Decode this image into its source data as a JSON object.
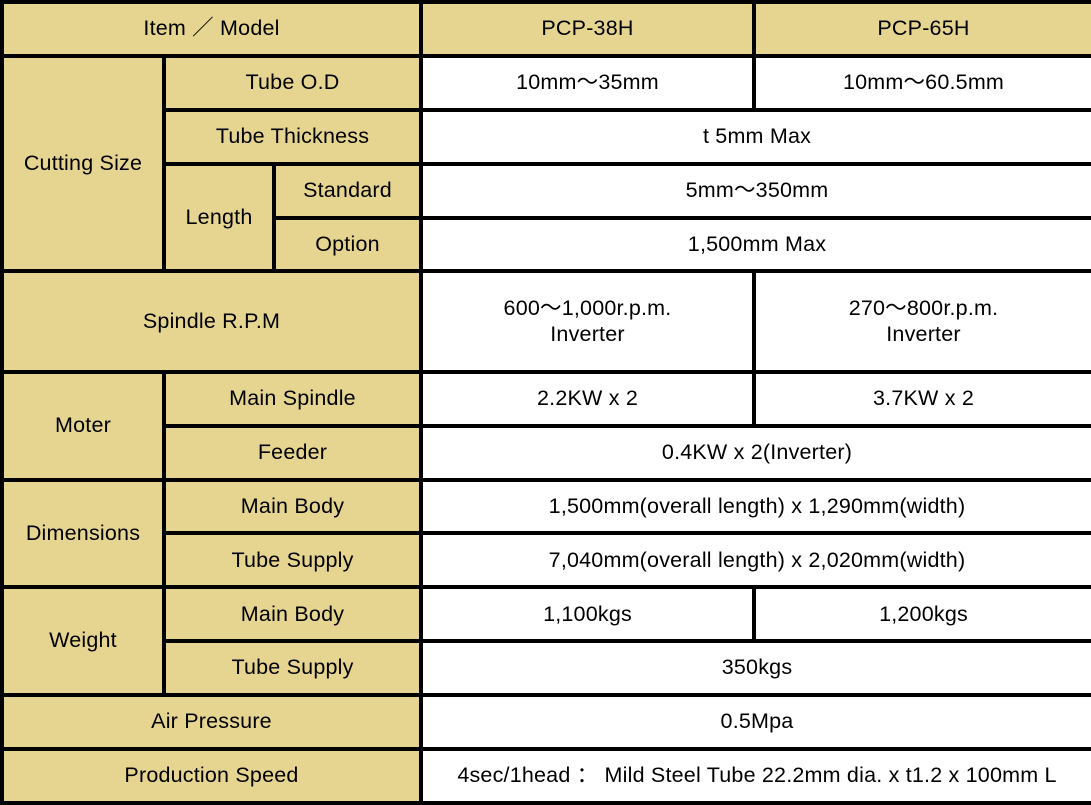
{
  "table": {
    "header": {
      "item_model": "Item ／ Model",
      "models": [
        "PCP-38H",
        "PCP-65H"
      ]
    },
    "colors": {
      "label_background": "#E5D590",
      "value_background": "#FFFFFF",
      "border": "#000000",
      "text": "#000000"
    },
    "rows": {
      "cutting_size": {
        "label": "Cutting Size",
        "tube_od": {
          "label": "Tube O.D",
          "pcp38h": "10mm～35mm",
          "pcp65h": "10mm～60.5mm"
        },
        "tube_thickness": {
          "label": "Tube Thickness",
          "value": "t 5mm Max"
        },
        "length": {
          "label": "Length",
          "standard": {
            "label": "Standard",
            "value": "5mm～350mm"
          },
          "option": {
            "label": "Option",
            "value": "1,500mm Max"
          }
        }
      },
      "spindle_rpm": {
        "label": "Spindle R.P.M",
        "pcp38h_line1": "600～1,000r.p.m.",
        "pcp38h_line2": "Inverter",
        "pcp65h_line1": "270～800r.p.m.",
        "pcp65h_line2": "Inverter"
      },
      "moter": {
        "label": "Moter",
        "main_spindle": {
          "label": "Main Spindle",
          "pcp38h": "2.2KW x 2",
          "pcp65h": "3.7KW x 2"
        },
        "feeder": {
          "label": "Feeder",
          "value": "0.4KW x 2(Inverter)"
        }
      },
      "dimensions": {
        "label": "Dimensions",
        "main_body": {
          "label": "Main Body",
          "value": "1,500mm(overall length) x 1,290mm(width)"
        },
        "tube_supply": {
          "label": "Tube Supply",
          "value": "7,040mm(overall length) x 2,020mm(width)"
        }
      },
      "weight": {
        "label": "Weight",
        "main_body": {
          "label": "Main Body",
          "pcp38h": "1,100kgs",
          "pcp65h": "1,200kgs"
        },
        "tube_supply": {
          "label": "Tube Supply",
          "value": "350kgs"
        }
      },
      "air_pressure": {
        "label": "Air Pressure",
        "value": "0.5Mpa"
      },
      "production_speed": {
        "label": "Production Speed",
        "value": "4sec/1head ： Mild Steel Tube 22.2mm dia. x t1.2 x 100mm L"
      }
    }
  }
}
